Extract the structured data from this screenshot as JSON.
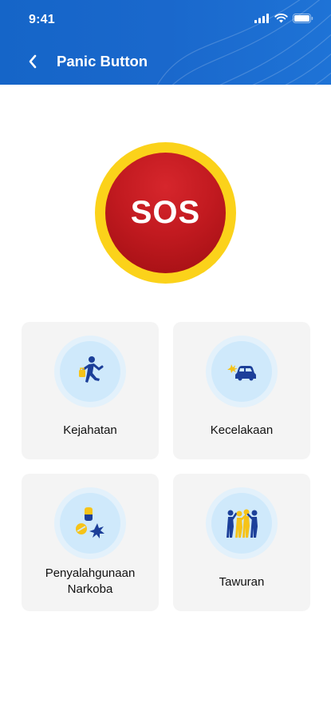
{
  "status_bar": {
    "time": "9:41"
  },
  "header": {
    "title": "Panic Button"
  },
  "sos": {
    "label": "SOS"
  },
  "categories": [
    {
      "label": "Kejahatan",
      "icon": "running-thief-icon"
    },
    {
      "label": "Kecelakaan",
      "icon": "car-crash-icon"
    },
    {
      "label_line1": "Penyalahgunaan",
      "label_line2": "Narkoba",
      "icon": "drug-pills-icon"
    },
    {
      "label": "Tawuran",
      "icon": "street-fight-icon"
    }
  ],
  "colors": {
    "header_blue": "#1565c8",
    "sos_red": "#c21a20",
    "sos_ring": "#fbd21a",
    "icon_navy": "#1c3f99",
    "icon_yellow": "#f6c318",
    "card_bg": "#f4f4f4"
  }
}
